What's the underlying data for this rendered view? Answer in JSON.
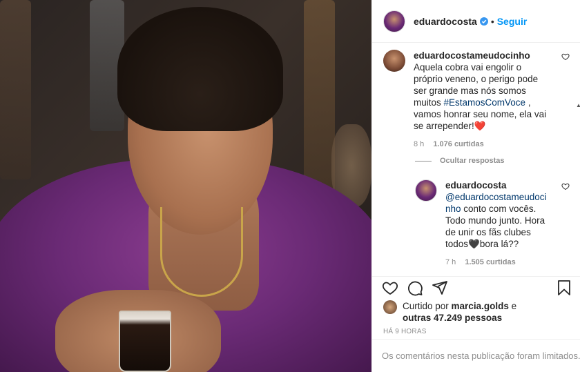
{
  "post": {
    "author": "eduardocosta",
    "follow_label": "Seguir",
    "dot": "•"
  },
  "comments": [
    {
      "username": "eduardocostameudocinho",
      "text_before": "Aquela cobra vai engolir o próprio veneno, o perigo pode ser grande mas nós somos muitos ",
      "hashtag": "#EstamosComVoce",
      "text_after": " , vamos honrar seu nome, ela vai se arrepender!",
      "emoji": "❤️",
      "time": "8 h",
      "likes": "1.076 curtidas"
    }
  ],
  "hide_replies_label": "Ocultar respostas",
  "reply": {
    "username": "eduardocosta",
    "mention_line1": "@eduardocostameudoci",
    "mention_line2": "nho",
    "text": " conto com vocês. Todo mundo junto. Hora de unir os fãs clubes todos",
    "emoji": "🖤",
    "text_after": "bora lá??",
    "time": "7 h",
    "likes": "1.505 curtidas"
  },
  "likes_summary": {
    "prefix": "Curtido por ",
    "liker": "marcia.golds",
    "middle": " e",
    "others": "outras 47.249 pessoas"
  },
  "timestamp": "HÁ 9 HORAS",
  "comments_limited": "Os comentários nesta publicação foram limitados.",
  "icons": {
    "verified": "verified-badge-icon",
    "like": "heart-icon",
    "comment": "comment-bubble-icon",
    "share": "paper-plane-icon",
    "save": "bookmark-icon"
  },
  "colors": {
    "link_blue": "#0095f6",
    "hashtag": "#00376b",
    "heart_red": "#e0112b",
    "muted": "#8e8e8e"
  }
}
